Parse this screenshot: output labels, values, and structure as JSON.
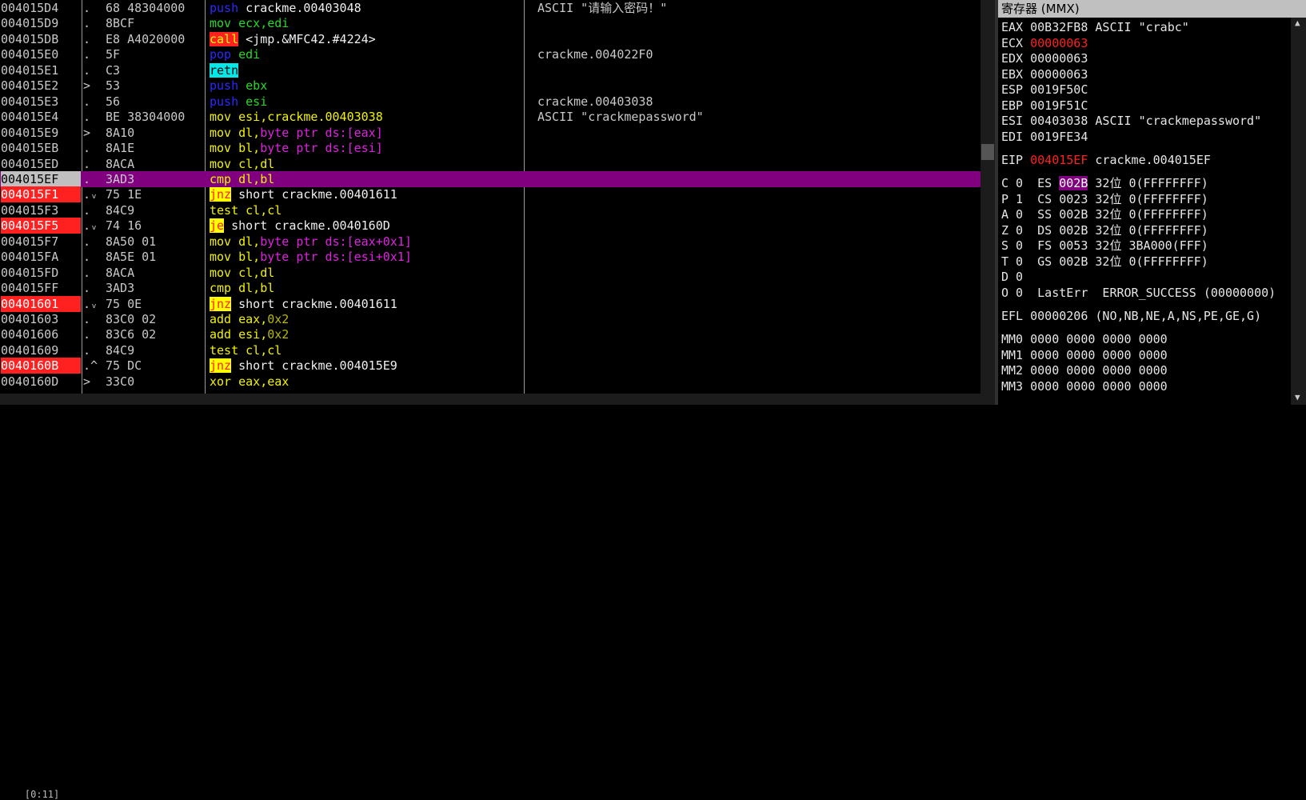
{
  "disasm": {
    "rows": [
      {
        "addr": "004015D4",
        "mark": ".",
        "hex": "68 48304000",
        "ins": [
          [
            "t-blue",
            "push"
          ],
          [
            "t-white",
            " crackme.00403048"
          ]
        ],
        "cmt": "ASCII \"请输入密码！\"",
        "addr_style": ""
      },
      {
        "addr": "004015D9",
        "mark": ".",
        "hex": "8BCF",
        "ins": [
          [
            "t-green",
            "mov"
          ],
          [
            "t-green",
            " ecx,edi"
          ]
        ],
        "cmt": "",
        "addr_style": ""
      },
      {
        "addr": "004015DB",
        "mark": ".",
        "hex": "E8 A4020000",
        "ins": [
          [
            "t-call",
            "call"
          ],
          [
            "t-white",
            " <jmp.&MFC42.#4224>"
          ]
        ],
        "cmt": "",
        "addr_style": ""
      },
      {
        "addr": "004015E0",
        "mark": ".",
        "hex": "5F",
        "ins": [
          [
            "t-blue",
            "pop"
          ],
          [
            "t-green",
            " edi"
          ]
        ],
        "cmt": "crackme.004022F0",
        "addr_style": ""
      },
      {
        "addr": "004015E1",
        "mark": ".",
        "hex": "C3",
        "ins": [
          [
            "t-retn",
            "retn"
          ]
        ],
        "cmt": "",
        "addr_style": ""
      },
      {
        "addr": "004015E2",
        "mark": ">",
        "hex": "53",
        "ins": [
          [
            "t-blue",
            "push"
          ],
          [
            "t-green",
            " ebx"
          ]
        ],
        "cmt": "",
        "addr_style": ""
      },
      {
        "addr": "004015E3",
        "mark": ".",
        "hex": "56",
        "ins": [
          [
            "t-blue",
            "push"
          ],
          [
            "t-green",
            " esi"
          ]
        ],
        "cmt": "crackme.00403038",
        "addr_style": ""
      },
      {
        "addr": "004015E4",
        "mark": ".",
        "hex": "BE 38304000",
        "ins": [
          [
            "t-yellowtxt",
            "mov"
          ],
          [
            "t-yellowtxt",
            " esi,crackme.00403038"
          ]
        ],
        "cmt": "ASCII \"crackmepassword\"",
        "addr_style": ""
      },
      {
        "addr": "004015E9",
        "mark": ">",
        "hex": "8A10",
        "ins": [
          [
            "t-yellowtxt",
            "mov"
          ],
          [
            "t-yellowtxt",
            " dl,"
          ],
          [
            "t-mag",
            "byte ptr ds:[eax]"
          ]
        ],
        "cmt": "",
        "addr_style": ""
      },
      {
        "addr": "004015EB",
        "mark": ".",
        "hex": "8A1E",
        "ins": [
          [
            "t-yellowtxt",
            "mov"
          ],
          [
            "t-yellowtxt",
            " bl,"
          ],
          [
            "t-mag",
            "byte ptr ds:[esi]"
          ]
        ],
        "cmt": "",
        "addr_style": ""
      },
      {
        "addr": "004015ED",
        "mark": ".",
        "hex": "8ACA",
        "ins": [
          [
            "t-yellowtxt",
            "mov"
          ],
          [
            "t-yellowtxt",
            " cl,dl"
          ]
        ],
        "cmt": "",
        "addr_style": ""
      },
      {
        "addr": "004015EF",
        "mark": ".",
        "hex": "3AD3",
        "ins": [
          [
            "t-yellowtxt",
            "cmp"
          ],
          [
            "t-yellowtxt",
            " dl,bl"
          ]
        ],
        "cmt": "",
        "addr_style": "cur",
        "selected": true
      },
      {
        "addr": "004015F1",
        "mark": ".ᵥ",
        "hex": "75 1E",
        "ins": [
          [
            "t-jmp",
            "jnz"
          ],
          [
            "t-white",
            " short crackme.00401611"
          ]
        ],
        "cmt": "",
        "addr_style": "bp"
      },
      {
        "addr": "004015F3",
        "mark": ".",
        "hex": "84C9",
        "ins": [
          [
            "t-yellowtxt",
            "test"
          ],
          [
            "t-yellowtxt",
            " cl,cl"
          ]
        ],
        "cmt": "",
        "addr_style": ""
      },
      {
        "addr": "004015F5",
        "mark": ".ᵥ",
        "hex": "74 16",
        "ins": [
          [
            "t-jmp",
            "je"
          ],
          [
            "t-white",
            " short crackme.0040160D"
          ]
        ],
        "cmt": "",
        "addr_style": "bp"
      },
      {
        "addr": "004015F7",
        "mark": ".",
        "hex": "8A50 01",
        "ins": [
          [
            "t-yellowtxt",
            "mov"
          ],
          [
            "t-yellowtxt",
            " dl,"
          ],
          [
            "t-mag",
            "byte ptr ds:[eax+0x1]"
          ]
        ],
        "cmt": "",
        "addr_style": ""
      },
      {
        "addr": "004015FA",
        "mark": ".",
        "hex": "8A5E 01",
        "ins": [
          [
            "t-yellowtxt",
            "mov"
          ],
          [
            "t-yellowtxt",
            " bl,"
          ],
          [
            "t-mag",
            "byte ptr ds:[esi+0x1]"
          ]
        ],
        "cmt": "",
        "addr_style": ""
      },
      {
        "addr": "004015FD",
        "mark": ".",
        "hex": "8ACA",
        "ins": [
          [
            "t-yellowtxt",
            "mov"
          ],
          [
            "t-yellowtxt",
            " cl,dl"
          ]
        ],
        "cmt": "",
        "addr_style": ""
      },
      {
        "addr": "004015FF",
        "mark": ".",
        "hex": "3AD3",
        "ins": [
          [
            "t-yellowtxt",
            "cmp"
          ],
          [
            "t-yellowtxt",
            " dl,bl"
          ]
        ],
        "cmt": "",
        "addr_style": ""
      },
      {
        "addr": "00401601",
        "mark": ".ᵥ",
        "hex": "75 0E",
        "ins": [
          [
            "t-jmp",
            "jnz"
          ],
          [
            "t-white",
            " short crackme.00401611"
          ]
        ],
        "cmt": "",
        "addr_style": "bp"
      },
      {
        "addr": "00401603",
        "mark": ".",
        "hex": "83C0 02",
        "ins": [
          [
            "t-yellowtxt",
            "add"
          ],
          [
            "t-yellowtxt",
            " eax,"
          ],
          [
            "t-olive",
            "0x2"
          ]
        ],
        "cmt": "",
        "addr_style": ""
      },
      {
        "addr": "00401606",
        "mark": ".",
        "hex": "83C6 02",
        "ins": [
          [
            "t-yellowtxt",
            "add"
          ],
          [
            "t-yellowtxt",
            " esi,"
          ],
          [
            "t-olive",
            "0x2"
          ]
        ],
        "cmt": "",
        "addr_style": ""
      },
      {
        "addr": "00401609",
        "mark": ".",
        "hex": "84C9",
        "ins": [
          [
            "t-yellowtxt",
            "test"
          ],
          [
            "t-yellowtxt",
            " cl,cl"
          ]
        ],
        "cmt": "",
        "addr_style": ""
      },
      {
        "addr": "0040160B",
        "mark": ".^",
        "hex": "75 DC",
        "ins": [
          [
            "t-jmp",
            "jnz"
          ],
          [
            "t-white",
            " short crackme.004015E9"
          ]
        ],
        "cmt": "",
        "addr_style": "bp"
      },
      {
        "addr": "0040160D",
        "mark": ">",
        "hex": "33C0",
        "ins": [
          [
            "t-yellowtxt",
            "xor"
          ],
          [
            "t-yellowtxt",
            " eax,eax"
          ]
        ],
        "cmt": "",
        "addr_style": ""
      }
    ],
    "status": "    [0:11]"
  },
  "registers": {
    "title": "寄存器 (MMX)",
    "gp": [
      {
        "name": "EAX",
        "val": "00B32FB8",
        "note": " ASCII \"crabc\"",
        "red": false
      },
      {
        "name": "ECX",
        "val": "00000063",
        "note": "",
        "red": true
      },
      {
        "name": "EDX",
        "val": "00000063",
        "note": "",
        "red": false
      },
      {
        "name": "EBX",
        "val": "00000063",
        "note": "",
        "red": false
      },
      {
        "name": "ESP",
        "val": "0019F50C",
        "note": "",
        "red": false
      },
      {
        "name": "EBP",
        "val": "0019F51C",
        "note": "",
        "red": false
      },
      {
        "name": "ESI",
        "val": "00403038",
        "note": " ASCII \"crackmepassword\"",
        "red": false
      },
      {
        "name": "EDI",
        "val": "0019FE34",
        "note": "",
        "red": false
      }
    ],
    "eip": {
      "name": "EIP",
      "val": "004015EF",
      "note": " crackme.004015EF"
    },
    "flags": [
      {
        "f": "C 0",
        "seg": "ES",
        "sel": "002B",
        "bits": "32位",
        "base": " 0(FFFFFFFF)",
        "hl": true
      },
      {
        "f": "P 1",
        "seg": "CS",
        "sel": "0023",
        "bits": "32位",
        "base": " 0(FFFFFFFF)",
        "hl": false
      },
      {
        "f": "A 0",
        "seg": "SS",
        "sel": "002B",
        "bits": "32位",
        "base": " 0(FFFFFFFF)",
        "hl": false
      },
      {
        "f": "Z 0",
        "seg": "DS",
        "sel": "002B",
        "bits": "32位",
        "base": " 0(FFFFFFFF)",
        "hl": false
      },
      {
        "f": "S 0",
        "seg": "FS",
        "sel": "0053",
        "bits": "32位",
        "base": " 3BA000(FFF)",
        "hl": false
      },
      {
        "f": "T 0",
        "seg": "GS",
        "sel": "002B",
        "bits": "32位",
        "base": " 0(FFFFFFFF)",
        "hl": false
      },
      {
        "f": "D 0",
        "seg": "",
        "sel": "",
        "bits": "",
        "base": "",
        "hl": false
      },
      {
        "f": "O 0",
        "seg": "LastErr",
        "sel": "",
        "bits": "",
        "base": " ERROR_SUCCESS (00000000)",
        "hl": false
      }
    ],
    "efl": "EFL 00000206 (NO,NB,NE,A,NS,PE,GE,G)",
    "mmx": [
      "MM0 0000 0000 0000 0000",
      "MM1 0000 0000 0000 0000",
      "MM2 0000 0000 0000 0000",
      "MM3 0000 0000 0000 0000"
    ]
  },
  "colors": {
    "selected_row": "#800080",
    "breakpoint": "#ff2020",
    "panel_title": "#c0c0c0"
  }
}
